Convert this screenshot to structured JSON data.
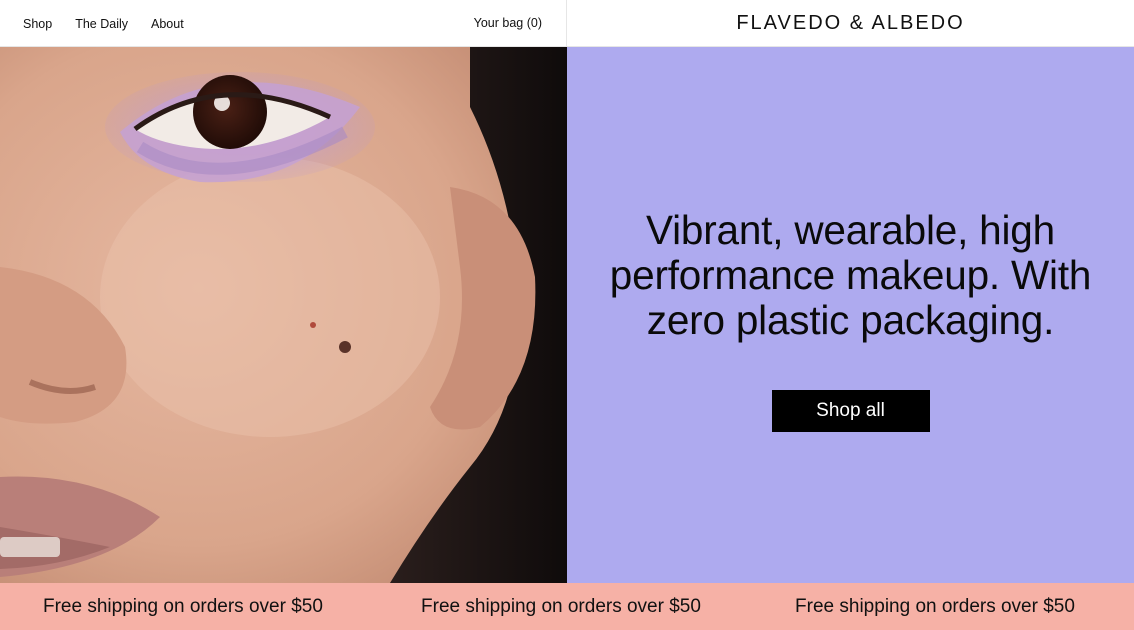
{
  "header": {
    "nav": [
      {
        "label": "Shop"
      },
      {
        "label": "The Daily"
      },
      {
        "label": "About"
      }
    ],
    "bag_label": "Your bag (0)",
    "logo": "FLAVEDO & ALBEDO"
  },
  "hero": {
    "image_alt": "close-up-face-lilac-eyeshadow",
    "headline": "Vibrant, wearable, high performance makeup. With zero plastic packaging.",
    "cta_label": "Shop all",
    "panel_color": "#aeaaef"
  },
  "banner": {
    "items": [
      "Free shipping on orders over $50",
      "Free shipping on orders over $50",
      "Free shipping on orders over $50"
    ],
    "color": "#f6b1a6"
  }
}
